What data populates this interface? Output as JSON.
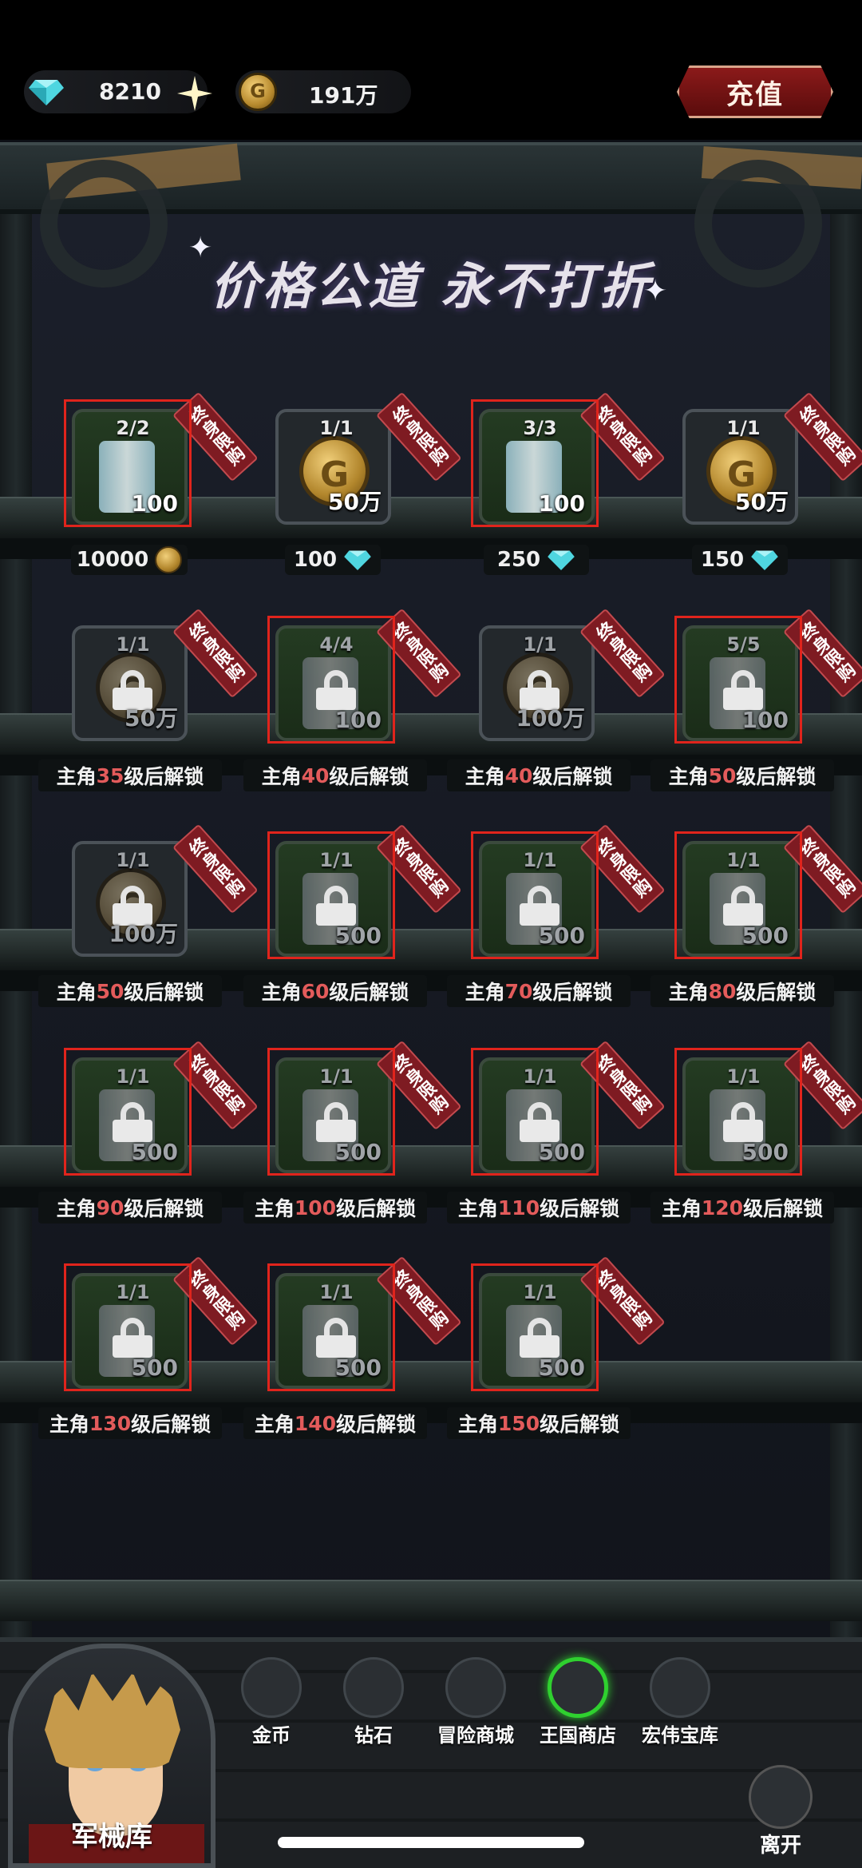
{
  "currency": {
    "gems": "8210",
    "coins": "191万"
  },
  "recharge_label": "充值",
  "slogan": "价格公道 永不打折",
  "tag_text": "终身限购",
  "colors": {
    "highlight": "#e0241c",
    "level_text": "#e35b5b",
    "active_tab": "#2fd02f"
  },
  "shelf_rows": [
    {
      "items": [
        {
          "count": "2/2",
          "qty": "100",
          "icon": "scroll-item-icon",
          "locked": false,
          "highlighted": true,
          "price": "10000",
          "price_icon": "coin-icon"
        },
        {
          "count": "1/1",
          "qty": "50万",
          "icon": "gold-coin-icon",
          "locked": false,
          "highlighted": false,
          "price": "100",
          "price_icon": "diamond-icon"
        },
        {
          "count": "3/3",
          "qty": "100",
          "icon": "scroll-item-icon",
          "locked": false,
          "highlighted": true,
          "price": "250",
          "price_icon": "diamond-icon"
        },
        {
          "count": "1/1",
          "qty": "50万",
          "icon": "gold-coin-icon",
          "locked": false,
          "highlighted": false,
          "price": "150",
          "price_icon": "diamond-icon"
        }
      ]
    },
    {
      "items": [
        {
          "count": "1/1",
          "qty": "50万",
          "icon": "gold-coin-icon",
          "locked": true,
          "highlighted": false,
          "unlock": [
            "主角",
            "35",
            "级后解锁"
          ]
        },
        {
          "count": "4/4",
          "qty": "100",
          "icon": "scroll-item-icon",
          "locked": true,
          "highlighted": true,
          "unlock": [
            "主角",
            "40",
            "级后解锁"
          ]
        },
        {
          "count": "1/1",
          "qty": "100万",
          "icon": "gold-coin-icon",
          "locked": true,
          "highlighted": false,
          "unlock": [
            "主角",
            "40",
            "级后解锁"
          ]
        },
        {
          "count": "5/5",
          "qty": "100",
          "icon": "scroll-item-icon",
          "locked": true,
          "highlighted": true,
          "unlock": [
            "主角",
            "50",
            "级后解锁"
          ]
        }
      ]
    },
    {
      "items": [
        {
          "count": "1/1",
          "qty": "100万",
          "icon": "gold-coin-icon",
          "locked": true,
          "highlighted": false,
          "unlock": [
            "主角",
            "50",
            "级后解锁"
          ]
        },
        {
          "count": "1/1",
          "qty": "500",
          "icon": "scroll-item-icon",
          "locked": true,
          "highlighted": true,
          "unlock": [
            "主角",
            "60",
            "级后解锁"
          ]
        },
        {
          "count": "1/1",
          "qty": "500",
          "icon": "scroll-item-icon",
          "locked": true,
          "highlighted": true,
          "unlock": [
            "主角",
            "70",
            "级后解锁"
          ]
        },
        {
          "count": "1/1",
          "qty": "500",
          "icon": "scroll-item-icon",
          "locked": true,
          "highlighted": true,
          "unlock": [
            "主角",
            "80",
            "级后解锁"
          ]
        }
      ]
    },
    {
      "items": [
        {
          "count": "1/1",
          "qty": "500",
          "icon": "scroll-item-icon",
          "locked": true,
          "highlighted": true,
          "unlock": [
            "主角",
            "90",
            "级后解锁"
          ]
        },
        {
          "count": "1/1",
          "qty": "500",
          "icon": "scroll-item-icon",
          "locked": true,
          "highlighted": true,
          "unlock": [
            "主角",
            "100",
            "级后解锁"
          ]
        },
        {
          "count": "1/1",
          "qty": "500",
          "icon": "scroll-item-icon",
          "locked": true,
          "highlighted": true,
          "unlock": [
            "主角",
            "110",
            "级后解锁"
          ]
        },
        {
          "count": "1/1",
          "qty": "500",
          "icon": "scroll-item-icon",
          "locked": true,
          "highlighted": true,
          "unlock": [
            "主角",
            "120",
            "级后解锁"
          ]
        }
      ]
    },
    {
      "items": [
        {
          "count": "1/1",
          "qty": "500",
          "icon": "scroll-item-icon",
          "locked": true,
          "highlighted": true,
          "unlock": [
            "主角",
            "130",
            "级后解锁"
          ]
        },
        {
          "count": "1/1",
          "qty": "500",
          "icon": "scroll-item-icon",
          "locked": true,
          "highlighted": true,
          "unlock": [
            "主角",
            "140",
            "级后解锁"
          ]
        },
        {
          "count": "1/1",
          "qty": "500",
          "icon": "scroll-item-icon",
          "locked": true,
          "highlighted": true,
          "unlock": [
            "主角",
            "150",
            "级后解锁"
          ]
        }
      ]
    }
  ],
  "bottom_nav": {
    "armory_label": "军械库",
    "tabs": [
      {
        "label": "金币",
        "icon": "gold-coin-icon",
        "active": false
      },
      {
        "label": "钻石",
        "icon": "diamond-icon",
        "active": false
      },
      {
        "label": "冒险商城",
        "icon": "knight-helmet-icon",
        "active": false
      },
      {
        "label": "王国商店",
        "icon": "crown-icon",
        "active": true
      },
      {
        "label": "宏伟宝库",
        "icon": "treasure-eye-icon",
        "active": false
      }
    ],
    "exit_label": "离开"
  }
}
